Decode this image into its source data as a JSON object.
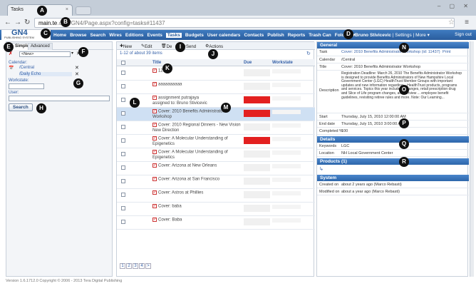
{
  "browser": {
    "tab_title": "Tasks",
    "url_host": "main.te",
    "url_rest": ".com/GN4/Page.aspx?config=tasks#11437"
  },
  "app": {
    "logo_text": "GN4",
    "logo_sub": "PUBLISHING SYSTEM",
    "nav": [
      "Home",
      "Browse",
      "Search",
      "Wires",
      "Editions",
      "Events",
      "Tasks",
      "Budgets",
      "User calendars",
      "Contacts",
      "Publish",
      "Reports",
      "Trash Can",
      "Folders ▾"
    ],
    "active_nav": "Tasks",
    "user": "Bruno Stivicevic",
    "settings": "Settings",
    "more": "More ▾",
    "signout": "Sign out"
  },
  "left": {
    "tab_simple": "Simple",
    "tab_advanced": "Advanced",
    "new_value": "<New>",
    "calendar_label": "Calendar:",
    "cal1": "/Central",
    "cal2": "/Daily Echo",
    "workstate_label": "Workstate:",
    "user_label": "User:",
    "search_button": "Search"
  },
  "center": {
    "toolbar": {
      "new": "New",
      "edit": "Edit",
      "delete": "De",
      "send": "Send",
      "actions": "Actions"
    },
    "count": "1-12 of about 39 items",
    "col_title": "Title",
    "col_due": "Due",
    "col_workstate": "Workstate",
    "rows": [
      {
        "title": "123"
      },
      {
        "title": "aaaaaaaaaa"
      },
      {
        "title": "assignment putrajaya",
        "sub": "assigned to: Bruno Stivicevic"
      },
      {
        "title": "Cover: 2010 Benefits Administrator Workshop"
      },
      {
        "title": "Cover: 2010 Regional Dinners - New Vision New Direction"
      },
      {
        "title": "Cover: A Molecular Understanding of Epigenetics"
      },
      {
        "title": "Cover: A Molecular Understanding of Epigenetics"
      },
      {
        "title": "Cover: Arizona at New Orleans"
      },
      {
        "title": "Cover: Arizona at San Francisco"
      },
      {
        "title": "Cover: Astros at Phillies"
      },
      {
        "title": "Cover: baba"
      },
      {
        "title": "Cover: Baba"
      }
    ],
    "pages": [
      "1",
      "2",
      "3",
      "4",
      ">"
    ]
  },
  "right": {
    "general_title": "General",
    "task_label": "Task",
    "task_value": "Cover: 2010 Benefits Administrator Workshop (id: 11437)",
    "print": "Print",
    "calendar_k": "Calendar",
    "calendar_v": "/Central",
    "title_k": "Title",
    "title_v": "Cover: 2010 Benefits Administrator Workshop",
    "desc_k": "Description",
    "desc_v": "Registration Deadline: March 26, 2010 The Benefits Administrator Workshop is designed to provide Benefits Administrators of New Hampshire Local Government Center (LGC) HealthTrust Member Groups with important updates and new information regarding... HealthTrust products, programs and services. Topics this year include ... changes, retail prescription drug and Slice of Life program changes, an overview ... employee benefit guidelines, revisiting retiree rules and more. Note: Our Learning...",
    "start_k": "Start",
    "start_v": "Thursday, July 15, 2010 12:00:00 AM",
    "end_k": "End date",
    "end_v": "Thursday, July 15, 2010 3:00:00 AM",
    "completed_k": "Completed %",
    "completed_v": "100",
    "details_title": "Details",
    "keywords_k": "Keywords",
    "keywords_v": "LGC",
    "location_k": "Location",
    "location_v": "NH Local Government Center",
    "products_title": "Products (1)",
    "system_title": "System",
    "created_k": "Created on",
    "created_v": "about 2 years ago (Marco Rebasti)",
    "modified_k": "Modified on",
    "modified_v": "about a year ago (Marco Rebasti)"
  },
  "footer": "Version 1.6.1712.0 Copyright © 2006 - 2013 Tera Digital Publishing",
  "markers": [
    "A",
    "B",
    "C",
    "D",
    "E",
    "F",
    "G",
    "H",
    "I",
    "J",
    "K",
    "L",
    "M",
    "N",
    "O",
    "P",
    "Q",
    "R"
  ]
}
